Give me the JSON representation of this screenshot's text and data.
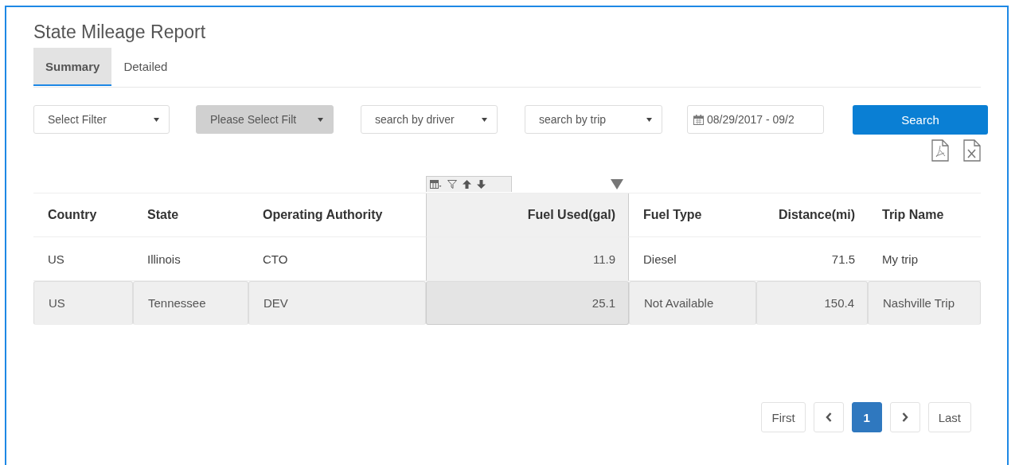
{
  "title": "State Mileage Report",
  "tabs": [
    {
      "label": "Summary",
      "selected": true
    },
    {
      "label": "Detailed",
      "selected": false
    }
  ],
  "filters": [
    {
      "kind": "select",
      "value": "Select Filter",
      "disabled": false
    },
    {
      "kind": "select",
      "value": "Please Select Filt",
      "disabled": true
    },
    {
      "kind": "select",
      "value": "search by driver",
      "disabled": false
    },
    {
      "kind": "select",
      "value": "search by trip",
      "disabled": false
    },
    {
      "kind": "date",
      "value": "08/29/2017 - 09/2",
      "disabled": false
    }
  ],
  "search_button": "Search",
  "table": {
    "columns": [
      {
        "label": "Country",
        "kind": "text",
        "highlighted": false
      },
      {
        "label": "State",
        "kind": "text",
        "highlighted": false
      },
      {
        "label": "Operating Authority",
        "kind": "text",
        "highlighted": false
      },
      {
        "label": "Fuel Used(gal)",
        "kind": "number",
        "highlighted": true
      },
      {
        "label": "Fuel Type",
        "kind": "text",
        "highlighted": false
      },
      {
        "label": "Distance(mi)",
        "kind": "number",
        "highlighted": false
      },
      {
        "label": "Trip Name",
        "kind": "text",
        "highlighted": false
      }
    ],
    "rows": [
      {
        "selected": false,
        "cells": [
          "US",
          "Illinois",
          "CTO",
          "11.9",
          "Diesel",
          "71.5",
          "My trip"
        ]
      },
      {
        "selected": true,
        "cells": [
          "US",
          "Tennessee",
          "DEV",
          "25.1",
          "Not Available",
          "150.4",
          "Nashville Trip"
        ]
      }
    ]
  },
  "pagination": [
    {
      "kind": "first",
      "label": "First",
      "selected": false
    },
    {
      "kind": "prev",
      "selected": false
    },
    {
      "kind": "page",
      "label": "1",
      "selected": true
    },
    {
      "kind": "next",
      "selected": false
    },
    {
      "kind": "last",
      "label": "Last",
      "selected": false
    }
  ]
}
